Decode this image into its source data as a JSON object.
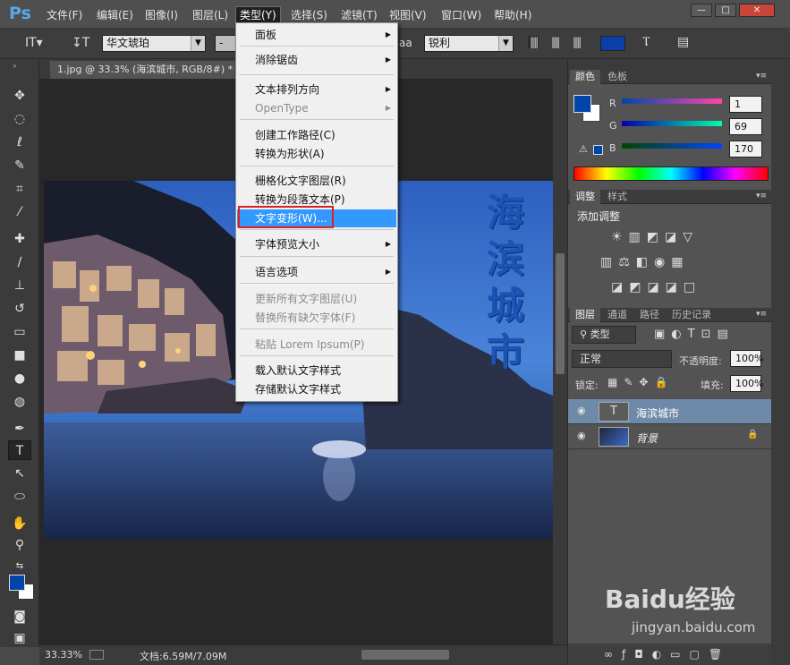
{
  "app": {
    "logo": "Ps"
  },
  "menubar": [
    "文件(F)",
    "编辑(E)",
    "图像(I)",
    "图层(L)",
    "类型(Y)",
    "选择(S)",
    "滤镜(T)",
    "视图(V)",
    "窗口(W)",
    "帮助(H)"
  ],
  "window_buttons": {
    "minimize": "—",
    "maximize": "□",
    "close": "✕"
  },
  "options": {
    "font_family": "华文琥珀",
    "font_style": "-",
    "aa_label": "aa",
    "aa_method": "锐利",
    "text_color": "#0b3fa8"
  },
  "document": {
    "tab": "1.jpg @ 33.3% (海滨城市, RGB/8#) *",
    "close": "×",
    "overlay_text": "海滨城市"
  },
  "type_menu": {
    "items": [
      {
        "label": "面板",
        "sub": true
      },
      {
        "label": "消除锯齿",
        "sub": true
      },
      {
        "label": "文本排列方向",
        "sub": true
      },
      {
        "label": "OpenType",
        "sub": true,
        "disabled": true
      },
      {
        "label": "创建工作路径(C)"
      },
      {
        "label": "转换为形状(A)"
      },
      {
        "label": "栅格化文字图层(R)"
      },
      {
        "label": "转换为段落文本(P)"
      },
      {
        "label": "文字变形(W)...",
        "selected": true
      },
      {
        "label": "字体预览大小",
        "sub": true
      },
      {
        "label": "语言选项",
        "sub": true
      },
      {
        "label": "更新所有文字图层(U)",
        "disabled": true
      },
      {
        "label": "替换所有缺欠字体(F)",
        "disabled": true
      },
      {
        "label": "粘贴 Lorem Ipsum(P)",
        "disabled": true
      },
      {
        "label": "载入默认文字样式"
      },
      {
        "label": "存储默认文字样式"
      }
    ]
  },
  "color_panel": {
    "tabs": [
      "颜色",
      "色板"
    ],
    "r_label": "R",
    "g_label": "G",
    "b_label": "B",
    "r": "1",
    "g": "69",
    "b": "170",
    "fg": "#0145aa",
    "bg": "#ffffff"
  },
  "adjust_panel": {
    "tabs": [
      "调整",
      "样式"
    ],
    "title": "添加调整"
  },
  "layers_panel": {
    "tabs": [
      "图层",
      "通道",
      "路径",
      "历史记录"
    ],
    "filter": "类型",
    "blend": "正常",
    "opacity_label": "不透明度:",
    "opacity": "100%",
    "lock_label": "锁定:",
    "fill_label": "填充:",
    "fill": "100%",
    "layers": [
      {
        "name": "海滨城市",
        "type": "T",
        "selected": true
      },
      {
        "name": "背景",
        "locked": true
      }
    ]
  },
  "status": {
    "zoom": "33.33%",
    "doc": "文档:6.59M/7.09M"
  },
  "watermark": {
    "brand": "Baidu经验",
    "site": "jingyan.baidu.com"
  }
}
